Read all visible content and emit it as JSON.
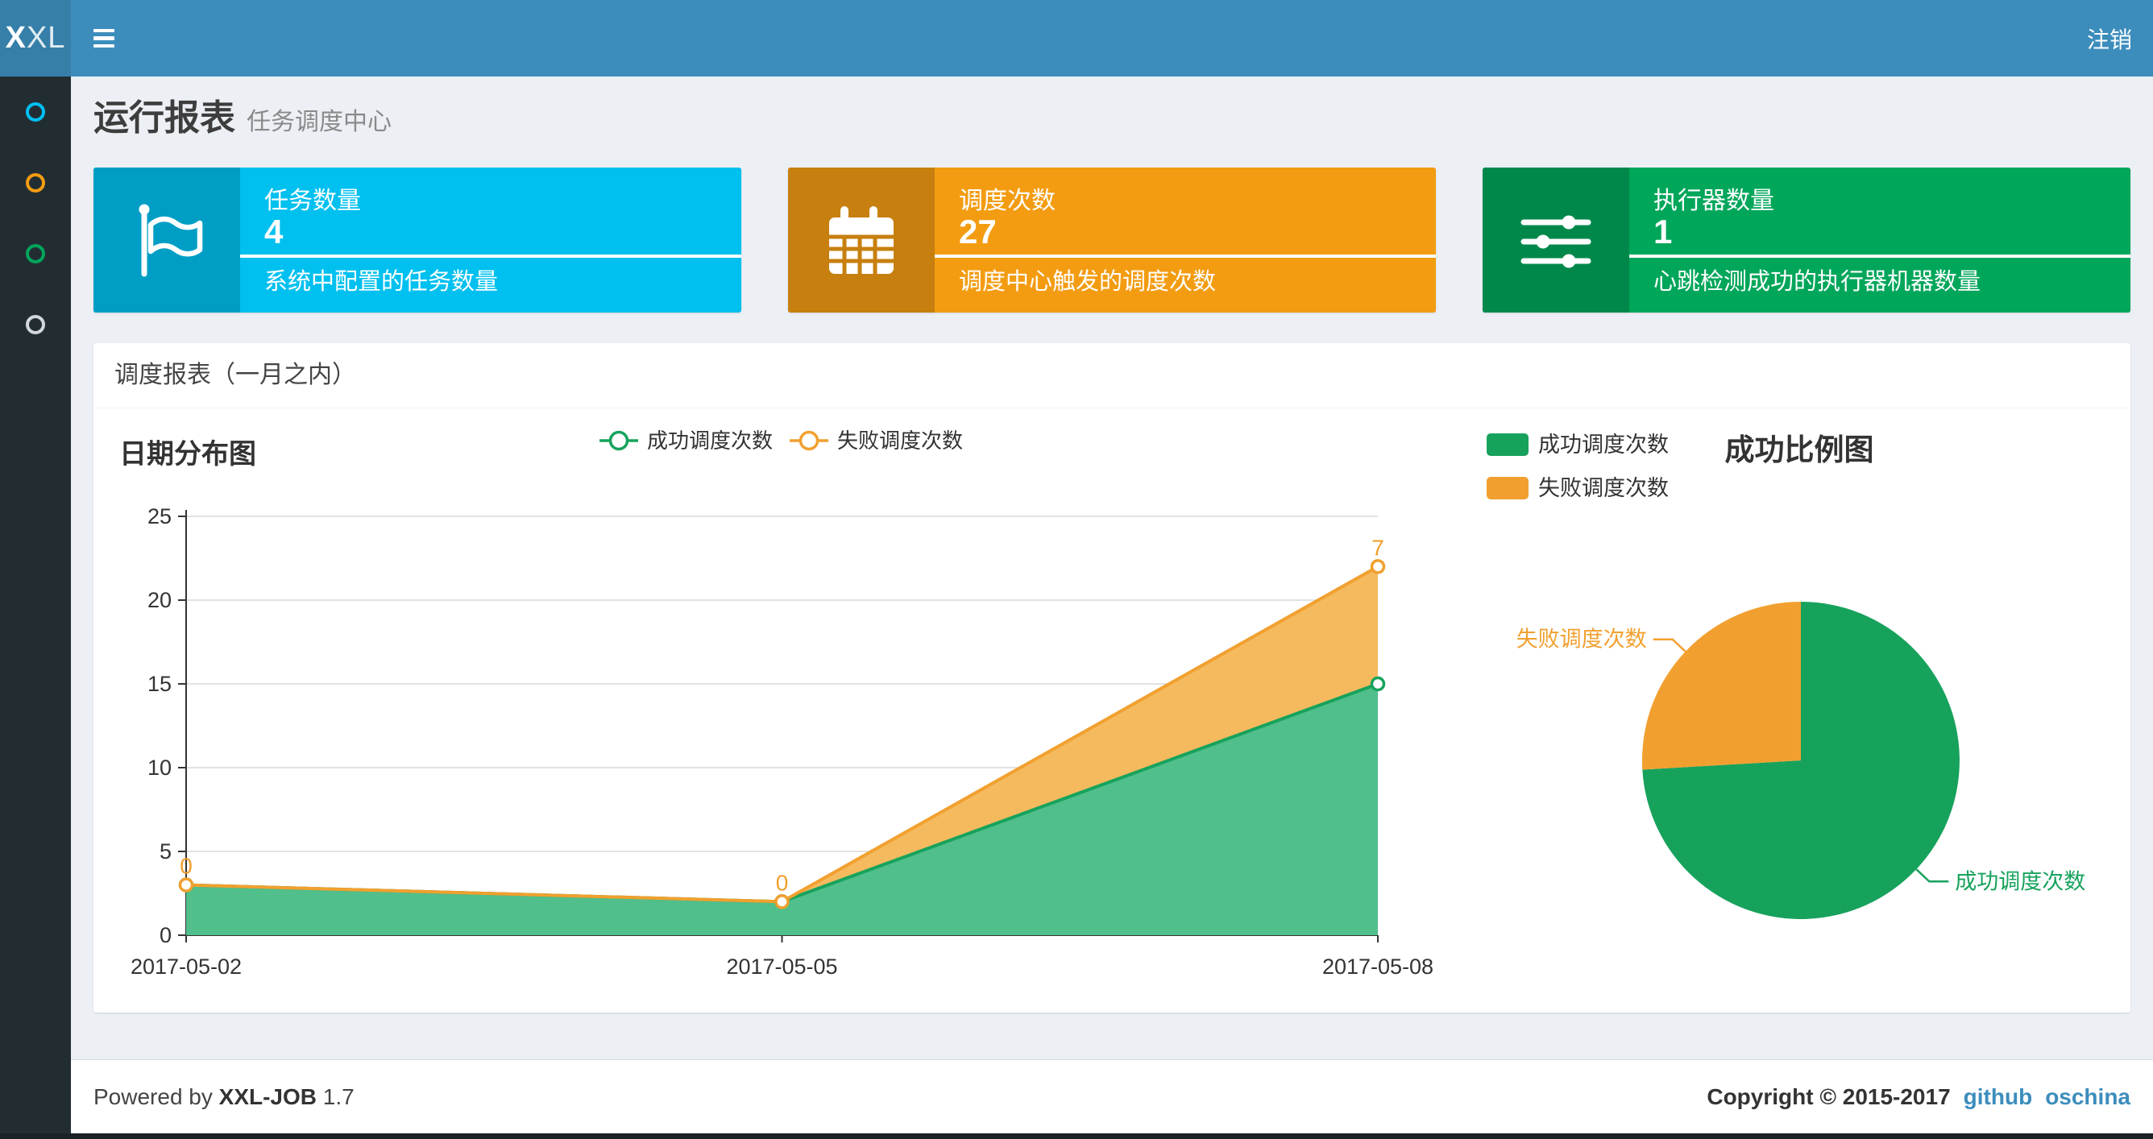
{
  "navbar": {
    "logo_bold": "X",
    "logo_light": "XL",
    "logout_label": "注销"
  },
  "sidebar": {
    "items": [
      {
        "icon": "circle-outline-icon",
        "color": "#00c0ef"
      },
      {
        "icon": "circle-outline-icon",
        "color": "#f39c12"
      },
      {
        "icon": "circle-outline-icon",
        "color": "#00a65a"
      },
      {
        "icon": "circle-outline-icon",
        "color": "#d2d6de"
      }
    ]
  },
  "page_header": {
    "title": "运行报表",
    "subtitle": "任务调度中心"
  },
  "stat_cards": [
    {
      "label": "任务数量",
      "value": "4",
      "description": "系统中配置的任务数量",
      "color": "#00c0ef",
      "icon_bg": "#009ec5",
      "icon": "flag-icon"
    },
    {
      "label": "调度次数",
      "value": "27",
      "description": "调度中心触发的调度次数",
      "color": "#f39c12",
      "icon_bg": "#c7800f",
      "icon": "calendar-icon"
    },
    {
      "label": "执行器数量",
      "value": "1",
      "description": "心跳检测成功的执行器机器数量",
      "color": "#00a65a",
      "icon_bg": "#00884a",
      "icon": "sliders-icon"
    }
  ],
  "report_panel": {
    "title": "调度报表（一月之内）"
  },
  "chart_data": [
    {
      "type": "area",
      "title": "日期分布图",
      "stacked": true,
      "categories": [
        "2017-05-02",
        "2017-05-05",
        "2017-05-08"
      ],
      "series": [
        {
          "name": "成功调度次数",
          "color": "#17a25c",
          "fill": "#50bf8b",
          "values": [
            3,
            2,
            15
          ],
          "show_labels": false
        },
        {
          "name": "失败调度次数",
          "color": "#f1a02f",
          "fill": "#f5ba5e",
          "values": [
            0,
            0,
            7
          ],
          "show_labels": true,
          "label_values": [
            "0",
            "0",
            "7"
          ]
        }
      ],
      "ylim": [
        0,
        25
      ],
      "yticks": [
        0,
        5,
        10,
        15,
        20,
        25
      ],
      "grid": true,
      "legend_position": "top-center",
      "axis_color": "#333333",
      "grid_color": "#d9d9d9"
    },
    {
      "type": "pie",
      "title": "成功比例图",
      "slices": [
        {
          "label": "成功调度次数",
          "value": 20,
          "color": "#17a25c"
        },
        {
          "label": "失败调度次数",
          "value": 7,
          "color": "#f1a02f"
        }
      ],
      "legend": [
        "成功调度次数",
        "失败调度次数"
      ],
      "legend_position": "top-left",
      "start_angle": 90,
      "direction": "clockwise"
    }
  ],
  "footer": {
    "powered_by_prefix": "Powered by",
    "product": "XXL-JOB",
    "version": "1.7",
    "copyright": "Copyright © 2015-2017",
    "links": [
      {
        "label": "github"
      },
      {
        "label": "oschina"
      }
    ]
  }
}
